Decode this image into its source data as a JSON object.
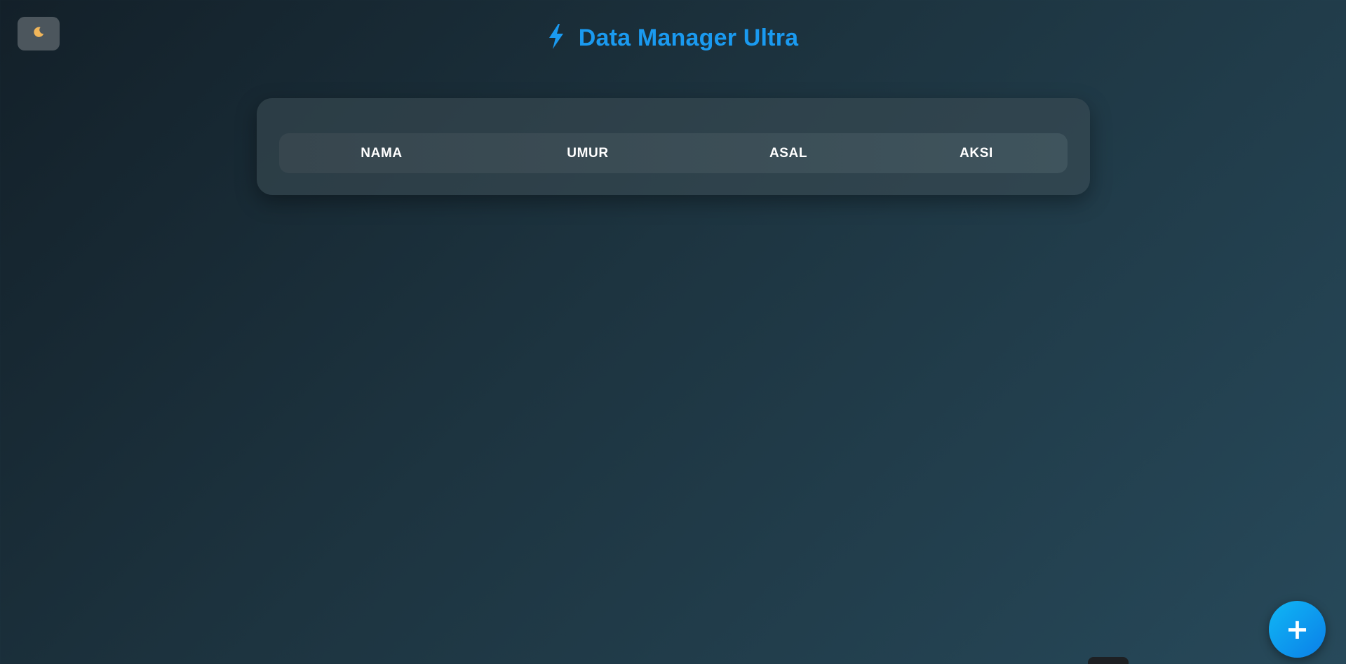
{
  "header": {
    "title": "Data Manager Ultra",
    "icon": "lightning-bolt-icon",
    "title_color": "#1a9af0"
  },
  "theme_toggle": {
    "icon": "crescent-moon-icon",
    "glyph": "🌙"
  },
  "table": {
    "columns": [
      "NAMA",
      "UMUR",
      "ASAL",
      "AKSI"
    ],
    "rows": []
  },
  "fab": {
    "icon": "plus-icon",
    "glyph": "+",
    "color": "#0b7fe8"
  }
}
